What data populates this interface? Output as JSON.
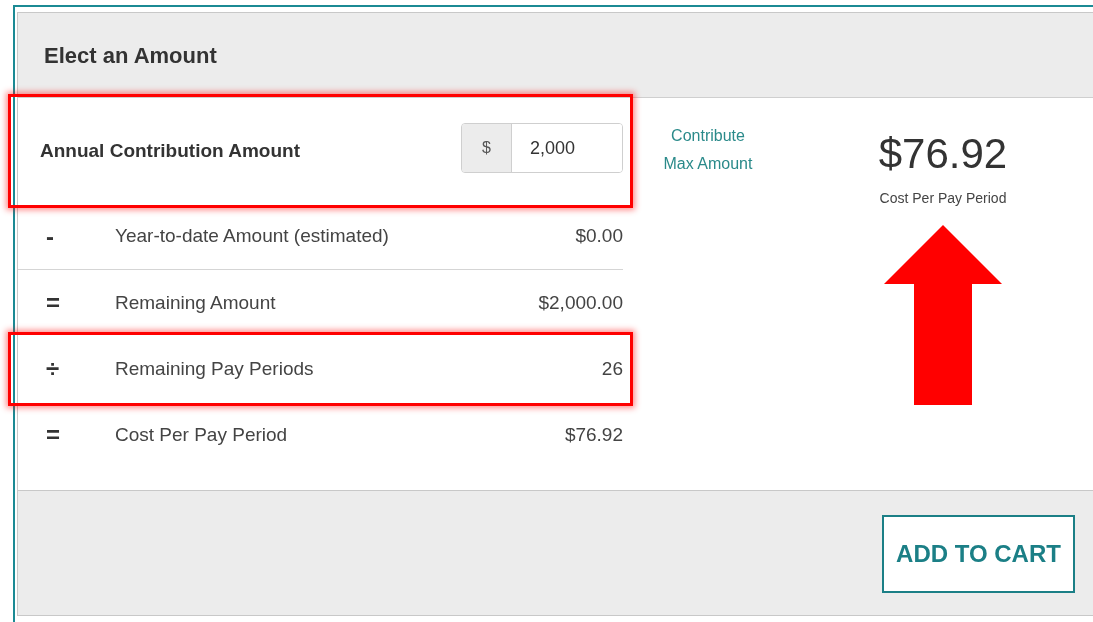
{
  "panel": {
    "title": "Elect an Amount"
  },
  "contribution": {
    "label": "Annual Contribution Amount",
    "currency": "$",
    "value": "2,000",
    "highlighted": true
  },
  "max_link": {
    "lines": [
      "Contribute",
      "Max Amount"
    ]
  },
  "rows": [
    {
      "operator": "-",
      "label": "Year-to-date Amount (estimated)",
      "value": "$0.00",
      "highlighted": false
    },
    {
      "operator": "=",
      "label": "Remaining Amount",
      "value": "$2,000.00",
      "highlighted": false
    },
    {
      "operator": "÷",
      "label": "Remaining Pay Periods",
      "value": "26",
      "highlighted": true
    },
    {
      "operator": "=",
      "label": "Cost Per Pay Period",
      "value": "$76.92",
      "highlighted": false
    }
  ],
  "summary": {
    "amount": "$76.92",
    "caption": "Cost Per Pay Period",
    "arrow": true
  },
  "footer": {
    "button": "ADD TO CART"
  }
}
